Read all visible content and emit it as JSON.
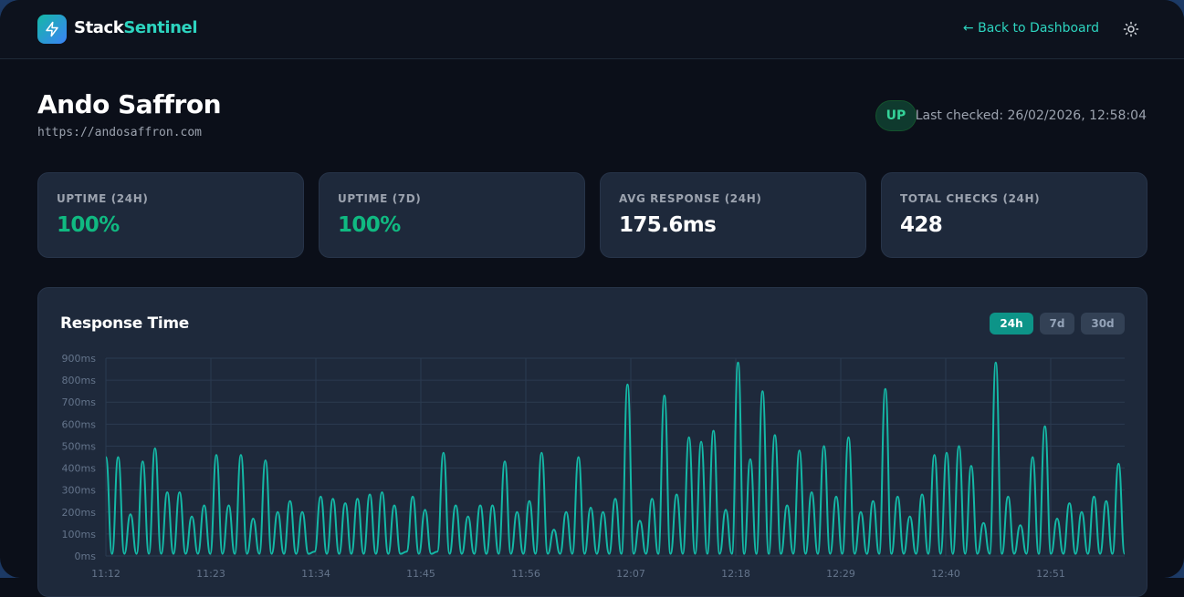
{
  "app": {
    "brand_part1": "Stack",
    "brand_part2": "Sentinel",
    "accent_color": "#2dd4bf",
    "logo_icon": "lightning-bolt-icon"
  },
  "nav": {
    "back_label": "← Back to Dashboard",
    "theme_icon": "sun-icon"
  },
  "monitor": {
    "name": "Ando Saffron",
    "url": "https://andosaffron.com",
    "status": "UP",
    "status_color": "#34d399",
    "last_checked": "Last checked: 26/02/2026, 12:58:04"
  },
  "stats": [
    {
      "label": "UPTIME (24H)",
      "value": "100%"
    },
    {
      "label": "UPTIME (7D)",
      "value": "100%"
    },
    {
      "label": "AVG RESPONSE (24H)",
      "value": "175.6ms"
    },
    {
      "label": "TOTAL CHECKS (24H)",
      "value": "428"
    }
  ],
  "chart_panel": {
    "title": "Response Time",
    "ranges": [
      "24h",
      "7d",
      "30d"
    ],
    "active_range": "24h"
  },
  "chart_data": {
    "type": "line",
    "title": "Response Time",
    "x_tick_labels": [
      "11:12",
      "11:23",
      "11:34",
      "11:45",
      "11:56",
      "12:07",
      "12:18",
      "12:29",
      "12:40",
      "12:51"
    ],
    "y_tick_labels": [
      "0ms",
      "100ms",
      "200ms",
      "300ms",
      "400ms",
      "500ms",
      "600ms",
      "700ms",
      "800ms",
      "900ms"
    ],
    "ylim": [
      0,
      900
    ],
    "y_unit": "ms",
    "line_color": "#14b8a6",
    "grid": true,
    "series": [
      {
        "values": [
          450,
          10,
          450,
          10,
          190,
          10,
          430,
          10,
          490,
          10,
          290,
          10,
          290,
          10,
          180,
          10,
          230,
          10,
          460,
          10,
          230,
          10,
          460,
          10,
          170,
          10,
          435,
          10,
          200,
          10,
          250,
          10,
          200,
          10,
          20,
          270,
          10,
          260,
          10,
          240,
          10,
          260,
          10,
          280,
          10,
          290,
          10,
          230,
          10,
          20,
          270,
          10,
          210,
          10,
          20,
          470,
          10,
          230,
          10,
          180,
          10,
          230,
          10,
          230,
          10,
          430,
          10,
          200,
          10,
          250,
          10,
          470,
          10,
          120,
          10,
          200,
          10,
          450,
          10,
          220,
          10,
          200,
          10,
          260,
          10,
          780,
          10,
          160,
          10,
          260,
          10,
          730,
          10,
          280,
          10,
          540,
          10,
          520,
          10,
          570,
          10,
          210,
          10,
          880,
          10,
          440,
          10,
          750,
          10,
          550,
          10,
          230,
          10,
          480,
          10,
          290,
          10,
          500,
          10,
          270,
          10,
          540,
          10,
          200,
          10,
          250,
          10,
          760,
          10,
          270,
          10,
          180,
          10,
          280,
          10,
          460,
          10,
          470,
          10,
          500,
          10,
          410,
          10,
          150,
          10,
          880,
          10,
          270,
          10,
          140,
          10,
          450,
          10,
          590,
          10,
          170,
          10,
          240,
          10,
          200,
          10,
          270,
          10,
          250,
          10,
          420,
          10
        ]
      }
    ]
  }
}
